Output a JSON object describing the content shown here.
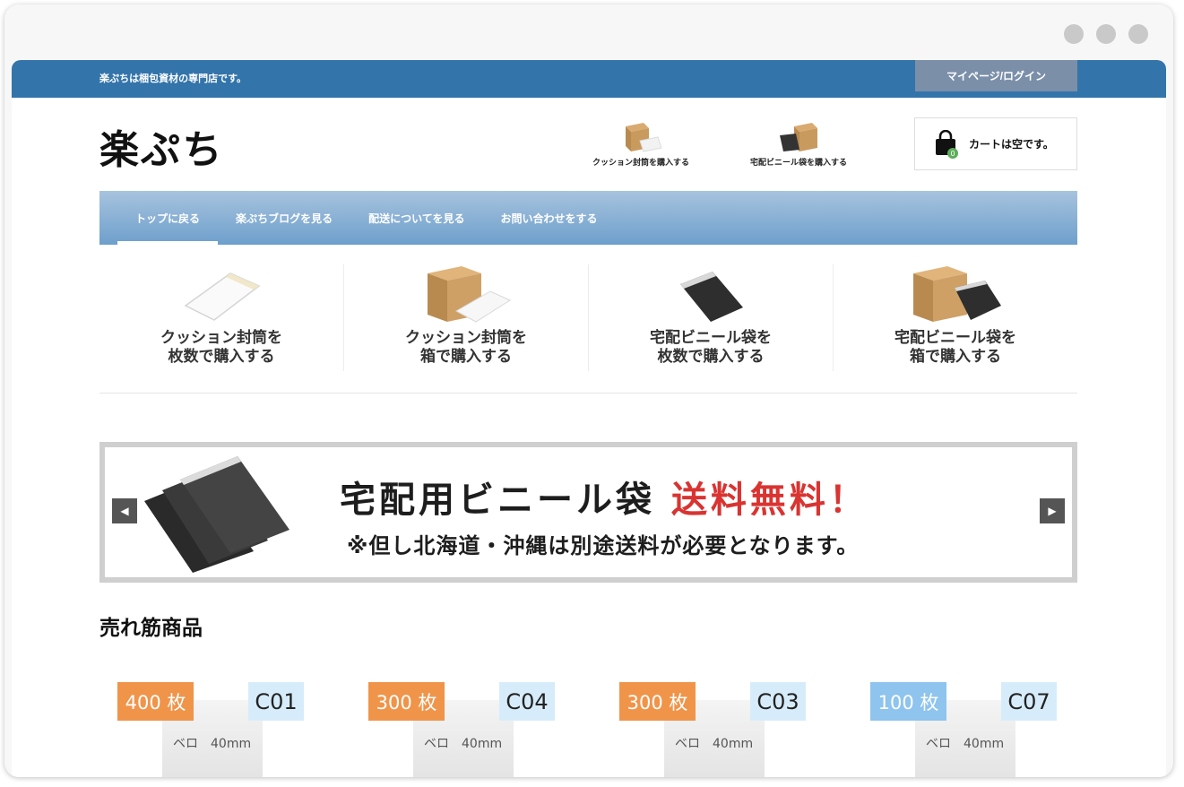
{
  "window": {
    "dot_color": "#c9c9c9"
  },
  "topbar": {
    "tagline": "楽ぷちは梱包資材の専門店です。",
    "login_label": "マイページ/ログイン",
    "bg_color": "#3374aa"
  },
  "header": {
    "logo": "楽ぷち",
    "links": [
      {
        "label": "クッション封筒を購入する",
        "icon": "cushion-envelope-box-icon"
      },
      {
        "label": "宅配ビニール袋を購入する",
        "icon": "vinyl-bag-box-icon"
      }
    ],
    "cart": {
      "label": "カートは空です。",
      "count": "0",
      "icon": "shopping-bag-icon"
    }
  },
  "nav": {
    "items": [
      {
        "label": "トップに戻る",
        "active": true
      },
      {
        "label": "楽ぷちブログを見る"
      },
      {
        "label": "配送についてを見る"
      },
      {
        "label": "お問い合わせをする"
      }
    ]
  },
  "categories": [
    {
      "label": "クッション封筒を\n枚数で購入する",
      "icon": "white-envelope-icon"
    },
    {
      "label": "クッション封筒を\n箱で購入する",
      "icon": "box-with-envelope-icon"
    },
    {
      "label": "宅配ビニール袋を\n枚数で購入する",
      "icon": "black-bag-icon"
    },
    {
      "label": "宅配ビニール袋を\n箱で購入する",
      "icon": "box-with-black-bag-icon"
    }
  ],
  "banner": {
    "headline_black": "宅配用ビニール袋",
    "headline_red": "送料無料！",
    "subline": "※但し北海道・沖縄は別途送料が必要となります。",
    "prev_icon": "chevron-left-icon",
    "next_icon": "chevron-right-icon",
    "accent_color": "#d93431"
  },
  "bestsellers": {
    "title": "売れ筋商品",
    "items": [
      {
        "qty": "400 枚",
        "code": "C01",
        "spec": "ベロ　40mm",
        "qty_color": "orange"
      },
      {
        "qty": "300 枚",
        "code": "C04",
        "spec": "ベロ　40mm",
        "qty_color": "orange"
      },
      {
        "qty": "300 枚",
        "code": "C03",
        "spec": "ベロ　40mm",
        "qty_color": "orange"
      },
      {
        "qty": "100 枚",
        "code": "C07",
        "spec": "ベロ　40mm",
        "qty_color": "blue"
      }
    ]
  }
}
